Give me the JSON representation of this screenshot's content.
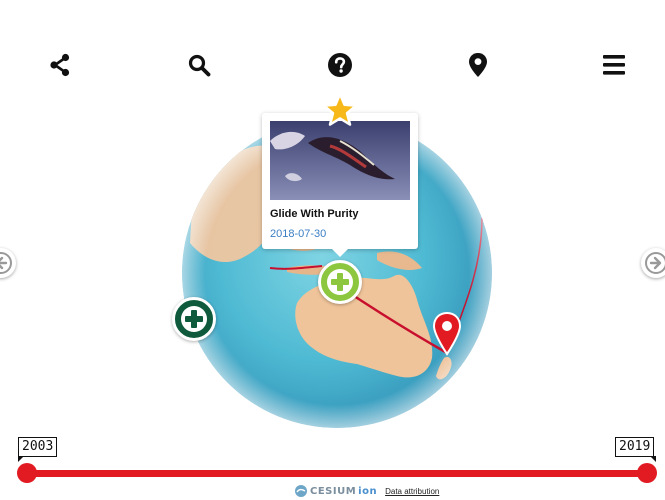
{
  "toolbar": {
    "items": [
      {
        "name": "share",
        "icon": "share-icon"
      },
      {
        "name": "search",
        "icon": "search-icon"
      },
      {
        "name": "help",
        "icon": "question-circle-icon"
      },
      {
        "name": "location",
        "icon": "map-marker-icon"
      },
      {
        "name": "menu",
        "icon": "hamburger-menu-icon"
      }
    ]
  },
  "popup": {
    "title": "Glide With Purity",
    "date": "2018-07-30",
    "image_icon": "photo-thumbnail",
    "badge_icon": "star-icon"
  },
  "markers": {
    "add_selected_icon": "plus-circle-icon",
    "add_other_icon": "plus-circle-icon",
    "destination_icon": "map-pin-icon"
  },
  "navigation": {
    "prev_icon": "arrow-left-circle-icon",
    "next_icon": "arrow-right-circle-icon"
  },
  "timeline": {
    "start_year": "2003",
    "end_year": "2019"
  },
  "credits": {
    "logo_text": "CESIUM",
    "ion_text": "ion",
    "attribution_link": "Data attribution"
  },
  "colors": {
    "accent_red": "#e21b22",
    "marker_green": "#8dc63f",
    "marker_dark_green": "#0f5a3c",
    "star_yellow": "#f7b81a",
    "date_blue": "#3b7fc4"
  }
}
